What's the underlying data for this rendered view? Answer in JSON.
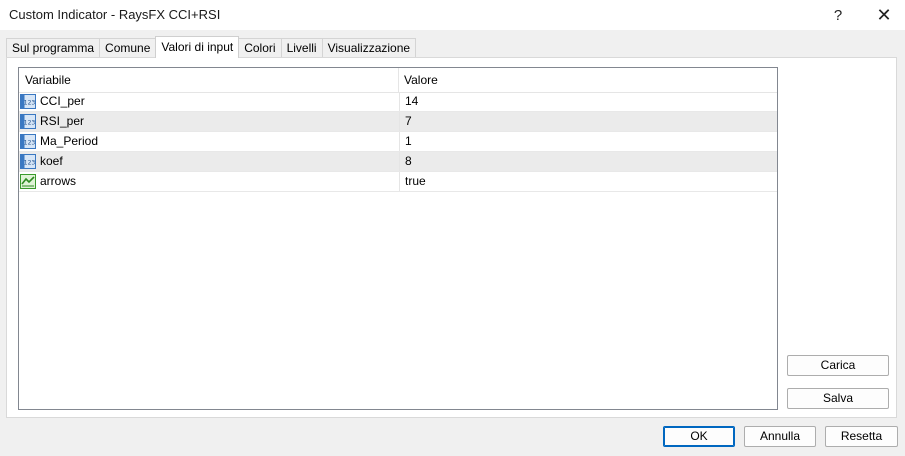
{
  "window": {
    "title": "Custom Indicator - RaysFX CCI+RSI",
    "help": "?",
    "close": "✕"
  },
  "tabs": [
    {
      "label": "Sul programma",
      "active": false
    },
    {
      "label": "Comune",
      "active": false
    },
    {
      "label": "Valori di input",
      "active": true
    },
    {
      "label": "Colori",
      "active": false
    },
    {
      "label": "Livelli",
      "active": false
    },
    {
      "label": "Visualizzazione",
      "active": false
    }
  ],
  "grid": {
    "columns": [
      "Variabile",
      "Valore"
    ],
    "rows": [
      {
        "name": "CCI_per",
        "value": "14",
        "type": "integer"
      },
      {
        "name": "RSI_per",
        "value": "7",
        "type": "integer"
      },
      {
        "name": "Ma_Period",
        "value": "1",
        "type": "integer"
      },
      {
        "name": "koef",
        "value": "8",
        "type": "integer"
      },
      {
        "name": "arrows",
        "value": "true",
        "type": "boolean"
      }
    ]
  },
  "side_buttons": {
    "load": "Carica",
    "save": "Salva"
  },
  "footer_buttons": {
    "ok": "OK",
    "cancel": "Annulla",
    "reset": "Resetta"
  },
  "colors": {
    "accent": "#0067c0",
    "alt_row": "#ebebeb"
  }
}
